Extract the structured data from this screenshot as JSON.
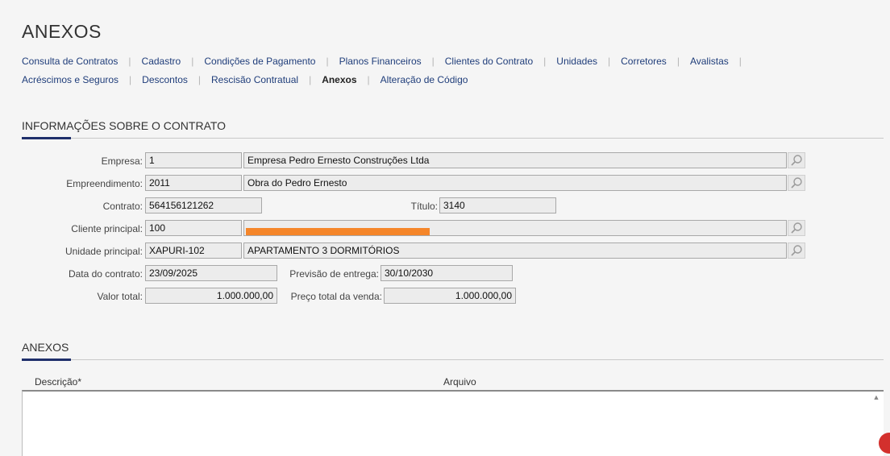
{
  "page": {
    "title": "ANEXOS"
  },
  "nav": {
    "row1": [
      {
        "label": "Consulta de Contratos"
      },
      {
        "label": "Cadastro"
      },
      {
        "label": "Condições de Pagamento"
      },
      {
        "label": "Planos Financeiros"
      },
      {
        "label": "Clientes do Contrato"
      },
      {
        "label": "Unidades"
      },
      {
        "label": "Corretores"
      },
      {
        "label": "Avalistas"
      }
    ],
    "row2": [
      {
        "label": "Acréscimos e Seguros"
      },
      {
        "label": "Descontos"
      },
      {
        "label": "Rescisão Contratual"
      },
      {
        "label": "Anexos",
        "active": true
      },
      {
        "label": "Alteração de Código"
      }
    ],
    "separator": "|"
  },
  "info_section": {
    "title": "INFORMAÇÕES SOBRE O CONTRATO",
    "empresa": {
      "label": "Empresa:",
      "code": "1",
      "name": "Empresa Pedro Ernesto Construções Ltda"
    },
    "empreendimento": {
      "label": "Empreendimento:",
      "code": "2011",
      "name": "Obra do Pedro Ernesto"
    },
    "contrato": {
      "label": "Contrato:",
      "value": "564156121262"
    },
    "titulo": {
      "label": "Título:",
      "value": "3140"
    },
    "cliente": {
      "label": "Cliente principal:",
      "code": "100",
      "name": ""
    },
    "unidade": {
      "label": "Unidade principal:",
      "code": "XAPURI-102",
      "name": "APARTAMENTO 3 DORMITÓRIOS"
    },
    "data_contrato": {
      "label": "Data do contrato:",
      "value": "23/09/2025"
    },
    "previsao_entrega": {
      "label": "Previsão de entrega:",
      "value": "30/10/2030"
    },
    "valor_total": {
      "label": "Valor total:",
      "value": "1.000.000,00"
    },
    "preco_total": {
      "label": "Preço total da venda:",
      "value": "1.000.000,00"
    }
  },
  "anexos_section": {
    "title": "ANEXOS",
    "columns": [
      "Descrição*",
      "Arquivo"
    ]
  },
  "colors": {
    "link": "#1f3d7a",
    "accent": "#1f2f6b",
    "redaction": "#f5862a"
  },
  "icons": {
    "lookup": "magnifier-icon",
    "scroll": "scroll-up-arrow-icon"
  }
}
